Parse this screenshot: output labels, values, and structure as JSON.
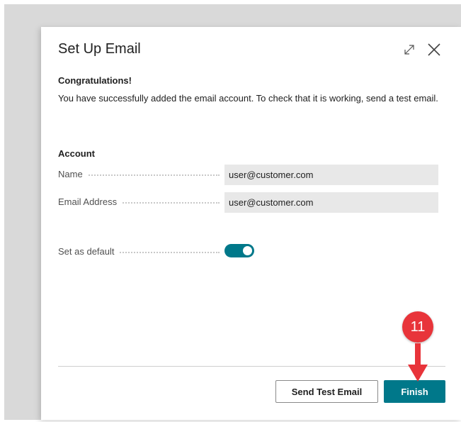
{
  "dialog": {
    "title": "Set Up Email",
    "congrats_heading": "Congratulations!",
    "message": "You have successfully added the email account. To check that it is working, send a test email.",
    "account_section_title": "Account",
    "fields": [
      {
        "label": "Name",
        "value": "user@customer.com"
      },
      {
        "label": "Email Address",
        "value": "user@customer.com"
      }
    ],
    "default_toggle": {
      "label": "Set as default",
      "checked": true
    },
    "buttons": {
      "send_test_email": "Send Test Email",
      "finish": "Finish"
    }
  },
  "annotation": {
    "step_number": "11",
    "color": "#e8343a"
  },
  "colors": {
    "accent": "#00788a",
    "field_bg": "#e8e8e8"
  }
}
